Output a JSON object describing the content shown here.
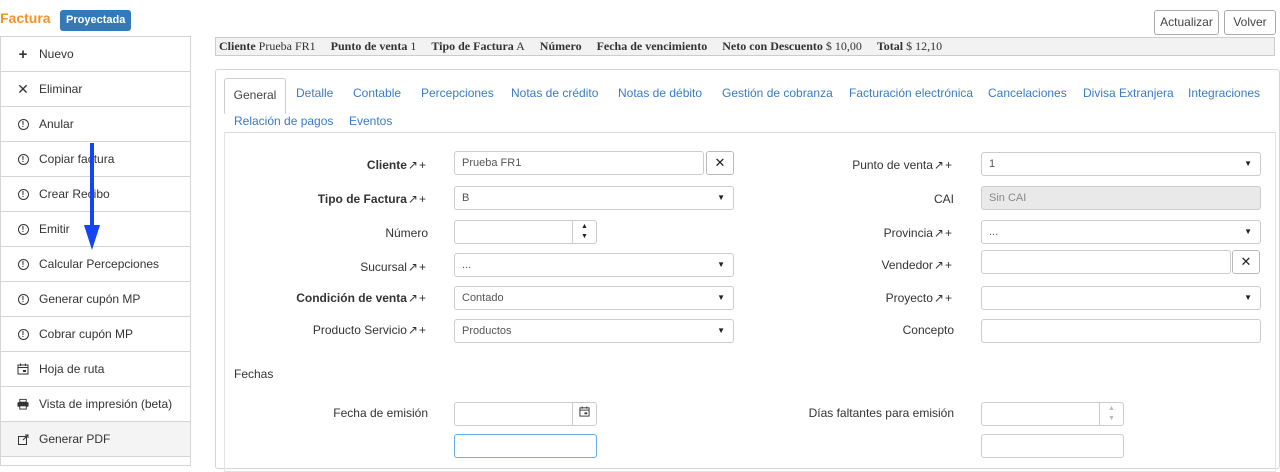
{
  "header": {
    "title": "Factura",
    "status_badge": "Proyectada",
    "refresh_label": "Actualizar",
    "back_label": "Volver"
  },
  "sidebar": {
    "items": [
      {
        "label": "Nuevo",
        "icon": "plus-icon"
      },
      {
        "label": "Eliminar",
        "icon": "times-icon"
      },
      {
        "label": "Anular",
        "icon": "alert-circle-icon"
      },
      {
        "label": "Copiar factura",
        "icon": "alert-circle-icon"
      },
      {
        "label": "Crear Recibo",
        "icon": "alert-circle-icon"
      },
      {
        "label": "Emitir",
        "icon": "alert-circle-icon"
      },
      {
        "label": "Calcular Percepciones",
        "icon": "alert-circle-icon"
      },
      {
        "label": "Generar cupón MP",
        "icon": "alert-circle-icon"
      },
      {
        "label": "Cobrar cupón MP",
        "icon": "alert-circle-icon"
      },
      {
        "label": "Hoja de ruta",
        "icon": "calendar-icon"
      },
      {
        "label": "Vista de impresión (beta)",
        "icon": "print-icon"
      },
      {
        "label": "Generar PDF",
        "icon": "external-link-icon"
      }
    ]
  },
  "summary": {
    "cliente_label": "Cliente",
    "cliente_value": "Prueba FR1",
    "punto_label": "Punto de venta",
    "punto_value": "1",
    "tipo_label": "Tipo de Factura",
    "tipo_value": "A",
    "numero_label": "Número",
    "venc_label": "Fecha de vencimiento",
    "neto_label": "Neto con Descuento",
    "neto_value": "$ 10,00",
    "total_label": "Total",
    "total_value": "$ 12,10"
  },
  "tabs": [
    "General",
    "Detalle",
    "Contable",
    "Percepciones",
    "Notas de crédito",
    "Notas de débito",
    "Gestión de cobranza",
    "Facturación electrónica",
    "Cancelaciones",
    "Divisa Extranjera",
    "Integraciones",
    "Relación de pagos",
    "Eventos"
  ],
  "form": {
    "cliente": {
      "label": "Cliente",
      "value": "Prueba FR1"
    },
    "tipo_factura": {
      "label": "Tipo de Factura",
      "value": "B"
    },
    "numero": {
      "label": "Número",
      "value": ""
    },
    "sucursal": {
      "label": "Sucursal",
      "value": "..."
    },
    "condicion_venta": {
      "label": "Condición de venta",
      "value": "Contado"
    },
    "producto_servicio": {
      "label": "Producto Servicio",
      "value": "Productos"
    },
    "punto_venta": {
      "label": "Punto de venta",
      "value": "1"
    },
    "cai": {
      "label": "CAI",
      "value": "Sin CAI"
    },
    "provincia": {
      "label": "Provincia",
      "value": "..."
    },
    "vendedor": {
      "label": "Vendedor",
      "value": ""
    },
    "proyecto": {
      "label": "Proyecto",
      "value": ""
    },
    "concepto": {
      "label": "Concepto",
      "value": ""
    },
    "fechas_section": "Fechas",
    "fecha_emision": {
      "label": "Fecha de emisión",
      "value": ""
    },
    "dias_faltantes": {
      "label": "Días faltantes para emisión",
      "value": ""
    },
    "link_plus": "+"
  },
  "colors": {
    "title": "#f0932b",
    "badge": "#337ab7",
    "tab_link": "#3a7bc8",
    "annotation_arrow": "#1246f0"
  }
}
